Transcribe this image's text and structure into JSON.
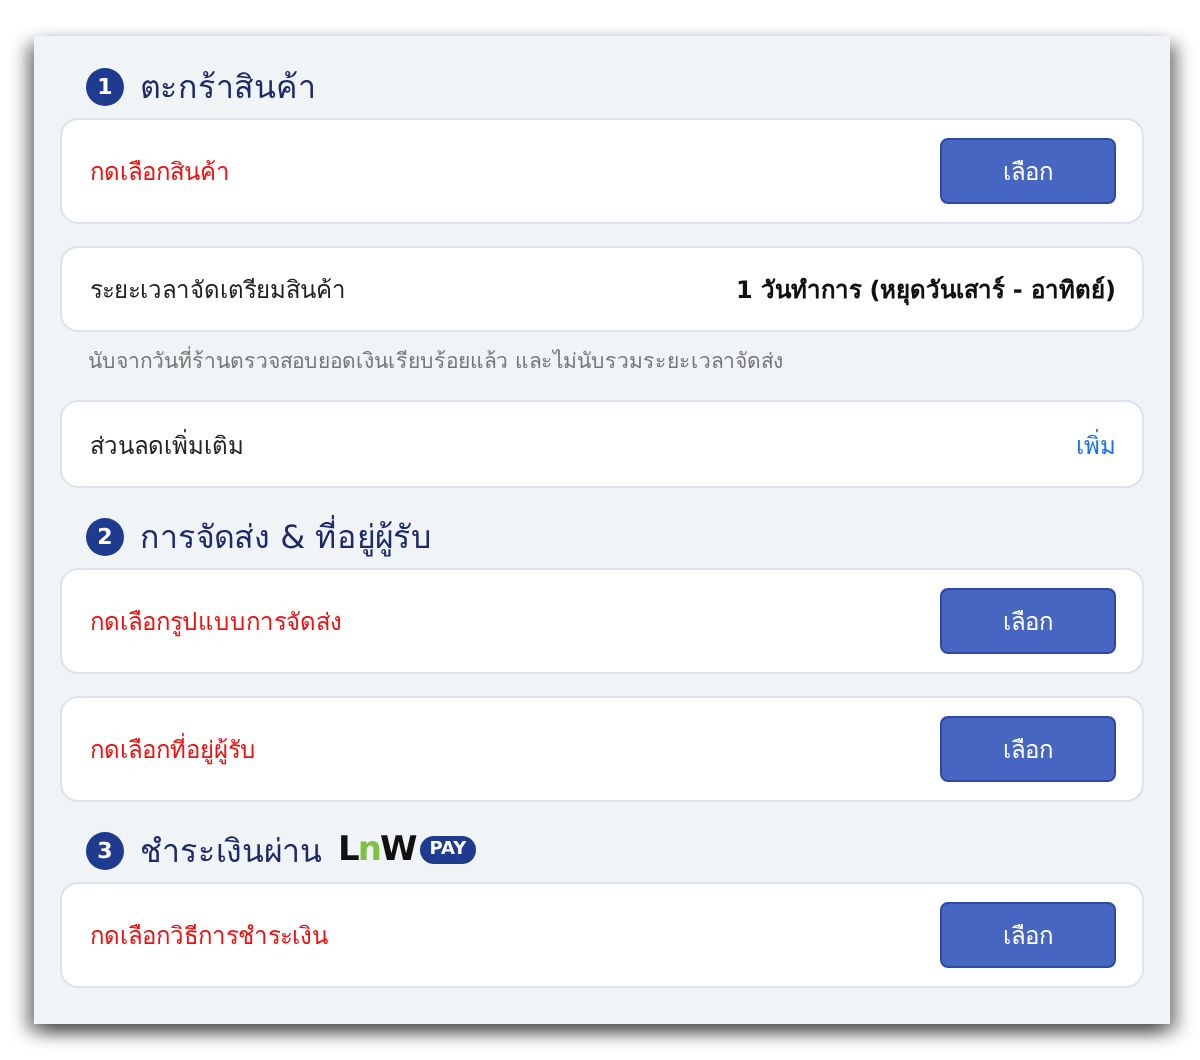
{
  "sections": [
    {
      "number": "1",
      "title": "ตะกร้าสินค้า",
      "items": [
        {
          "kind": "select",
          "prompt": "กดเลือกสินค้า",
          "button": "เลือก"
        },
        {
          "kind": "info",
          "label": "ระยะเวลาจัดเตรียมสินค้า",
          "value": "1 วันทำการ (หยุดวันเสาร์ - อาทิตย์)"
        },
        {
          "kind": "note",
          "text": "นับจากวันที่ร้านตรวจสอบยอดเงินเรียบร้อยแล้ว และไม่นับรวมระยะเวลาจัดส่ง"
        },
        {
          "kind": "action",
          "label": "ส่วนลดเพิ่มเติม",
          "link": "เพิ่ม"
        }
      ]
    },
    {
      "number": "2",
      "title": "การจัดส่ง & ที่อยู่ผู้รับ",
      "items": [
        {
          "kind": "select",
          "prompt": "กดเลือกรูปแบบการจัดส่ง",
          "button": "เลือก"
        },
        {
          "kind": "select",
          "prompt": "กดเลือกที่อยู่ผู้รับ",
          "button": "เลือก"
        }
      ]
    },
    {
      "number": "3",
      "title": "ชำระเงินผ่าน",
      "logo": {
        "letters": [
          "L",
          "n",
          "W"
        ],
        "badge": "PAY"
      },
      "items": [
        {
          "kind": "select",
          "prompt": "กดเลือกวิธีการชำระเงิน",
          "button": "เลือก"
        }
      ]
    }
  ]
}
